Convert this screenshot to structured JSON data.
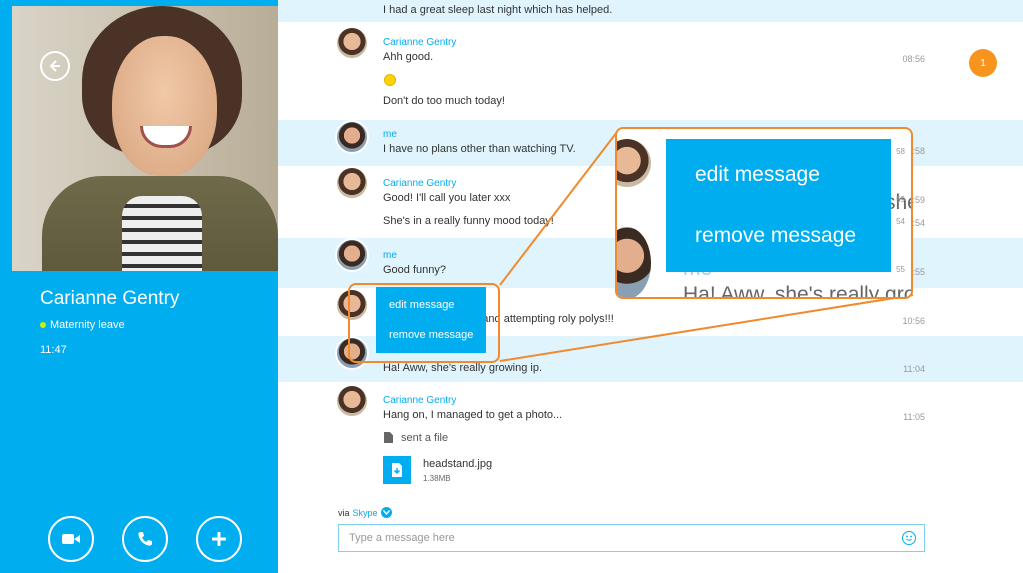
{
  "contact": {
    "name": "Carianne Gentry",
    "status": "Maternity leave",
    "local_time": "11:47"
  },
  "actions": [
    "video-call",
    "voice-call",
    "add"
  ],
  "notification_count": "1",
  "messages": [
    {
      "text": "I had a great sleep last night which has helped."
    },
    {
      "sender": "Carianne Gentry",
      "lines": [
        "Ahh good.",
        "Don't do too much today!"
      ],
      "time": "08:56"
    },
    {
      "sender": "me",
      "lines": [
        "I have no plans other than watching TV."
      ],
      "time": "08:58"
    },
    {
      "sender": "Carianne Gentry",
      "lines": [
        "Good! I'll call you later xxx",
        "She's in a really funny mood today!"
      ],
      "times": [
        "08:59",
        "10:54"
      ]
    },
    {
      "sender": "me",
      "lines": [
        "Good funny?"
      ],
      "time": "10:55"
    },
    {
      "sender": "Carianne Gentry",
      "lines": [
        "shes and attempting roly polys!!!"
      ],
      "time": "10:56"
    },
    {
      "sender": "me",
      "lines": [
        "Ha! Aww, she's really growing ip."
      ],
      "time": "11:04"
    },
    {
      "sender": "Carianne Gentry",
      "lines": [
        "Hang on, I managed to get a photo..."
      ],
      "time": "11:05"
    }
  ],
  "file": {
    "label": "sent a file",
    "name": "headstand.jpg",
    "size": "1.38MB"
  },
  "context_menu": {
    "edit": "edit message",
    "remove": "remove message"
  },
  "zoom": {
    "edit": "edit message",
    "remove": "remove message",
    "fragment_top": "she",
    "fragment_me": "me",
    "fragment_bottom": "Ha! Aww, she's really gro",
    "times": [
      "58",
      "59",
      "54",
      "55"
    ]
  },
  "composer": {
    "via_prefix": "via",
    "via_brand": "Skype",
    "placeholder": "Type a message here"
  },
  "colors": {
    "accent": "#00adef",
    "highlight_band": "#dff4fd",
    "callout": "#f08a2c",
    "notification": "#f7941d"
  }
}
